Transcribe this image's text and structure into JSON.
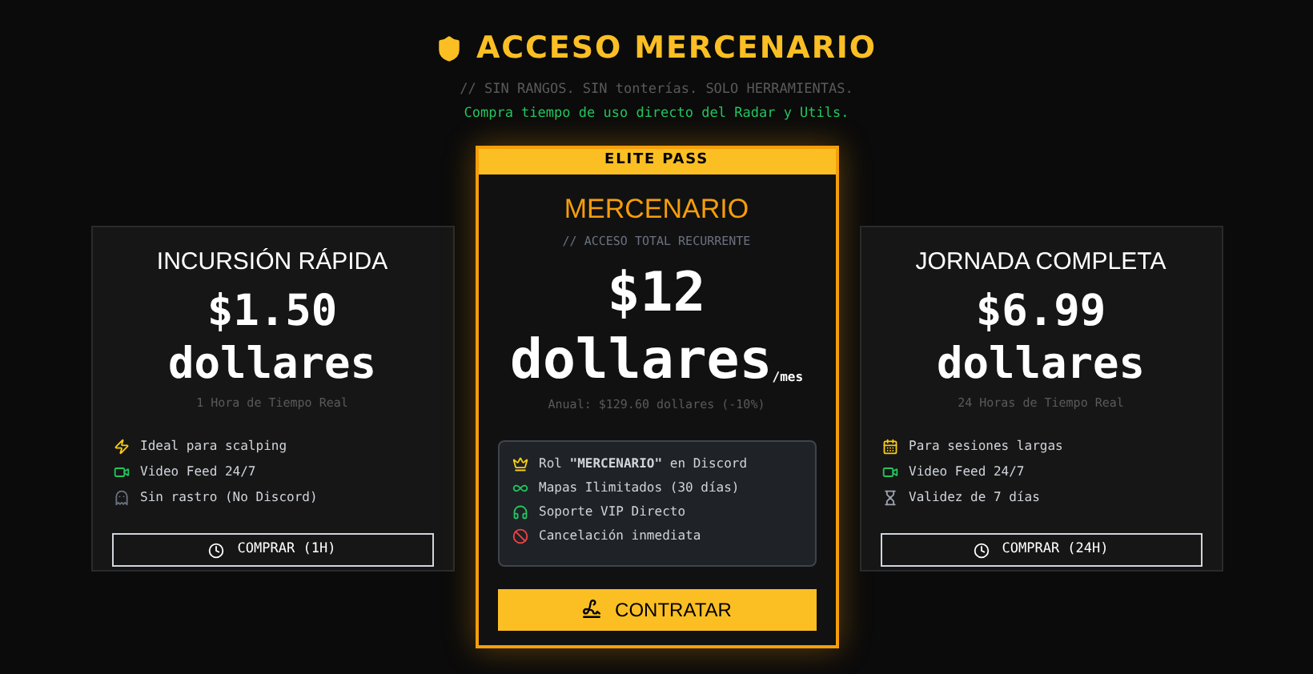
{
  "header": {
    "title": "ACCESO MERCENARIO",
    "tagline": "// SIN RANGOS. SIN tonterías. SOLO HERRAMIENTAS.",
    "subtitle": "Compra tiempo de uso directo del Radar y Utils."
  },
  "plans": [
    {
      "featured": false,
      "name": "INCURSIÓN RÁPIDA",
      "price": "$1.50",
      "unit": "dollares",
      "note": "1 Hora de Tiempo Real",
      "features": [
        {
          "kind": "bolt",
          "text": "Ideal para scalping"
        },
        {
          "kind": "video",
          "text": "Video Feed 24/7"
        },
        {
          "kind": "ghost",
          "text": "Sin rastro (No Discord)"
        }
      ],
      "button": {
        "kind": "clock",
        "label": "COMPRAR (1H)"
      }
    },
    {
      "featured": true,
      "badge": "ELITE PASS",
      "name": "MERCENARIO",
      "tagline": "// ACCESO TOTAL RECURRENTE",
      "price": "$12",
      "unit": "dollares",
      "period": "/mes",
      "note": "Anual: $129.60 dollares (-10%)",
      "features": [
        {
          "kind": "crown",
          "text": "Rol **\"MERCENARIO\"** en Discord"
        },
        {
          "kind": "infinity",
          "text": "Mapas Ilimitados (30 días)"
        },
        {
          "kind": "headset",
          "text": "Soporte VIP Directo"
        },
        {
          "kind": "ban",
          "text": "Cancelación inmediata"
        }
      ],
      "button": {
        "kind": "sign",
        "label": "CONTRATAR"
      }
    },
    {
      "featured": false,
      "name": "JORNADA COMPLETA",
      "price": "$6.99",
      "unit": "dollares",
      "note": "24 Horas de Tiempo Real",
      "features": [
        {
          "kind": "calendar",
          "text": "Para sesiones largas"
        },
        {
          "kind": "video",
          "text": "Video Feed 24/7"
        },
        {
          "kind": "hourglass",
          "text": "Validez de 7 días"
        }
      ],
      "button": {
        "kind": "clock",
        "label": "COMPRAR (24H)"
      }
    }
  ]
}
